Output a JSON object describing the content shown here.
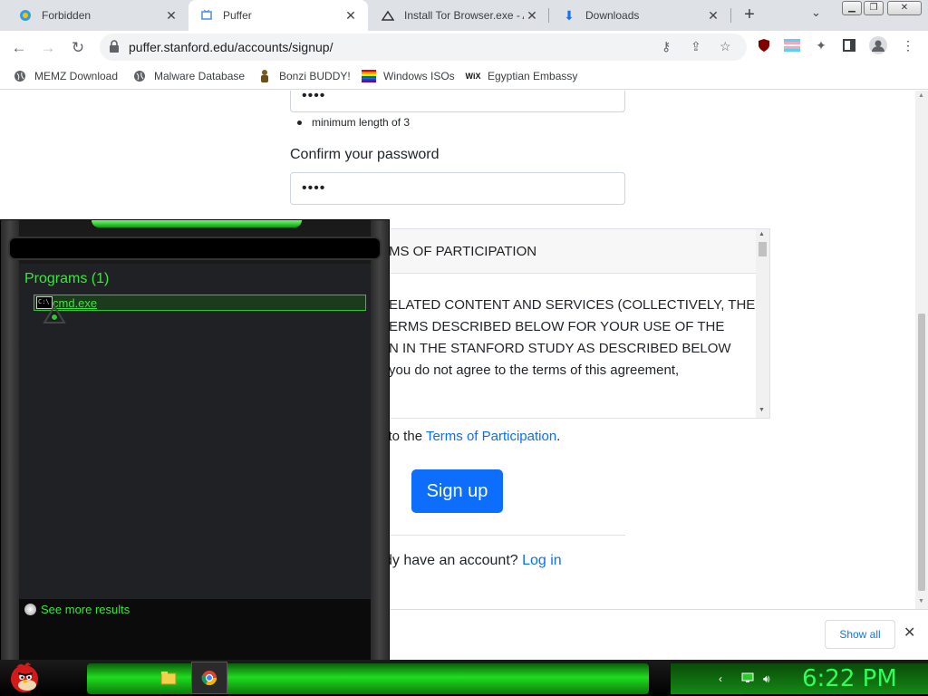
{
  "browser": {
    "tabs": [
      {
        "title": "Forbidden",
        "icon": "bonzi-icon",
        "active": false
      },
      {
        "title": "Puffer",
        "icon": "puffer-icon",
        "active": true
      },
      {
        "title": "Install Tor Browser.exe - A",
        "icon": "wikihow-icon",
        "active": false
      },
      {
        "title": "Downloads",
        "icon": "download-icon",
        "active": false
      }
    ],
    "new_tab_label": "+",
    "url": "puffer.stanford.edu/accounts/signup/",
    "bookmarks": [
      {
        "label": "MEMZ Download",
        "icon": "globe-icon"
      },
      {
        "label": "Malware Database",
        "icon": "globe-icon"
      },
      {
        "label": "Bonzi BUDDY!",
        "icon": "bonzi-icon"
      },
      {
        "label": "Windows ISOs",
        "icon": "windows-flag-icon"
      },
      {
        "label": "Egyptian Embassy",
        "icon": "wix-icon"
      }
    ]
  },
  "page": {
    "password_value": "••••",
    "password_hint": "minimum length of 3",
    "confirm_label": "Confirm your password",
    "confirm_value": "••••",
    "terms_heading": "MS OF PARTICIPATION",
    "terms_lines": [
      "ELATED CONTENT AND SERVICES (COLLECTIVELY, THE",
      "ERMS DESCRIBED BELOW FOR YOUR USE OF THE",
      "N IN THE STANFORD STUDY AS DESCRIBED BELOW",
      "you do not agree to the terms of this agreement,"
    ],
    "agree_prefix": "e to the ",
    "agree_link": "Terms of Participation",
    "agree_suffix": ".",
    "signup_button": "Sign up",
    "login_prefix": "dy have an account? ",
    "login_link": "Log in"
  },
  "download_bar": {
    "show_all": "Show all",
    "close": "✕"
  },
  "start_menu": {
    "results_heading": "Programs (1)",
    "result_item": "cmd.exe",
    "cmd_icon_text": "C:\\",
    "see_more": "See more results"
  },
  "taskbar": {
    "clock": "6:22 PM"
  },
  "colors": {
    "accent_green": "#38e838",
    "clock_green": "#2dff5a",
    "link_blue": "#0d6efd"
  }
}
